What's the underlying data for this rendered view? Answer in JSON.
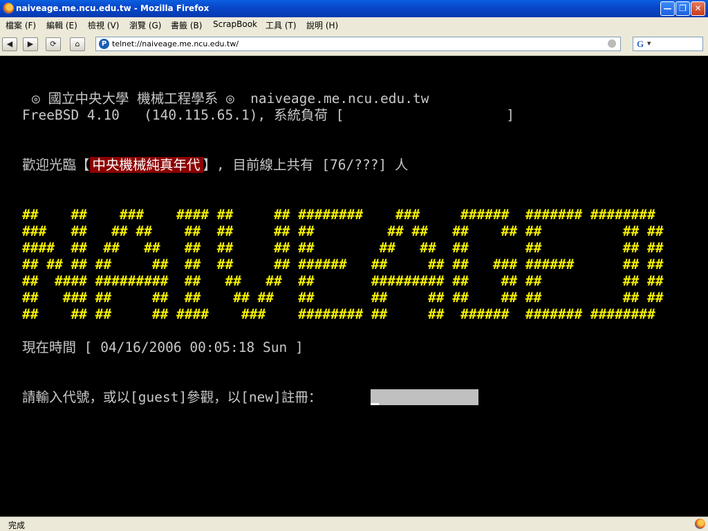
{
  "window": {
    "title": "naiveage.me.ncu.edu.tw - Mozilla Firefox",
    "minimize_glyph": "—",
    "maximize_glyph": "❐",
    "close_glyph": "✕"
  },
  "menu": {
    "items": [
      "檔案 (F)",
      "編輯 (E)",
      "檢視 (V)",
      "瀏覽 (G)",
      "書籤 (B)",
      "ScrapBook",
      "工具 (T)",
      "說明 (H)"
    ]
  },
  "toolbar": {
    "back_glyph": "◀",
    "forward_glyph": "▶",
    "reload_glyph": "⟳",
    "home_glyph": "⌂",
    "url": "telnet://naiveage.me.ncu.edu.tw/",
    "site_icon_glyph": "P",
    "search_engine_glyph": "G",
    "search_dropdown_glyph": "▼"
  },
  "terminal": {
    "header_line1": "◎ 國立中央大學 機械工程學系 ◎  naiveage.me.ncu.edu.tw",
    "header_line2": "FreeBSD 4.10   (140.115.65.1), 系統負荷 [                    ]",
    "welcome_prefix": "歡迎光臨【",
    "site_name": "中央機械純真年代",
    "welcome_suffix": "】, 目前線上共有 [76/???] 人",
    "ascii_art": [
      "##    ##    ###    #### ##     ## ########    ###     ######  ####### ########",
      "###   ##   ## ##    ##  ##     ## ##         ## ##   ##    ## ##          ## ##",
      "####  ##  ##   ##   ##  ##     ## ##        ##   ##  ##       ##          ## ##",
      "## ## ## ##     ##  ##  ##     ## ######   ##     ## ##   ### ######      ## ##",
      "##  #### #########  ##   ##   ##  ##       ######### ##    ## ##          ## ##",
      "##   ### ##     ##  ##    ## ##   ##       ##     ## ##    ## ##          ## ##",
      "##    ## ##     ## ####    ###    ######## ##     ##  ######  ####### ########"
    ],
    "time_line": "現在時間 [ 04/16/2006 00:05:18 Sun ]",
    "login_prompt": "請輸入代號，或以[guest]參觀，以[new]註冊："
  },
  "status": {
    "text": "完成"
  },
  "colors": {
    "terminal_bg": "#000000",
    "terminal_fg": "#c8c8c8",
    "ascii_fg": "#f6f200",
    "site_name_bg": "#8b0000",
    "login_field_bg": "#c0c0c0"
  }
}
